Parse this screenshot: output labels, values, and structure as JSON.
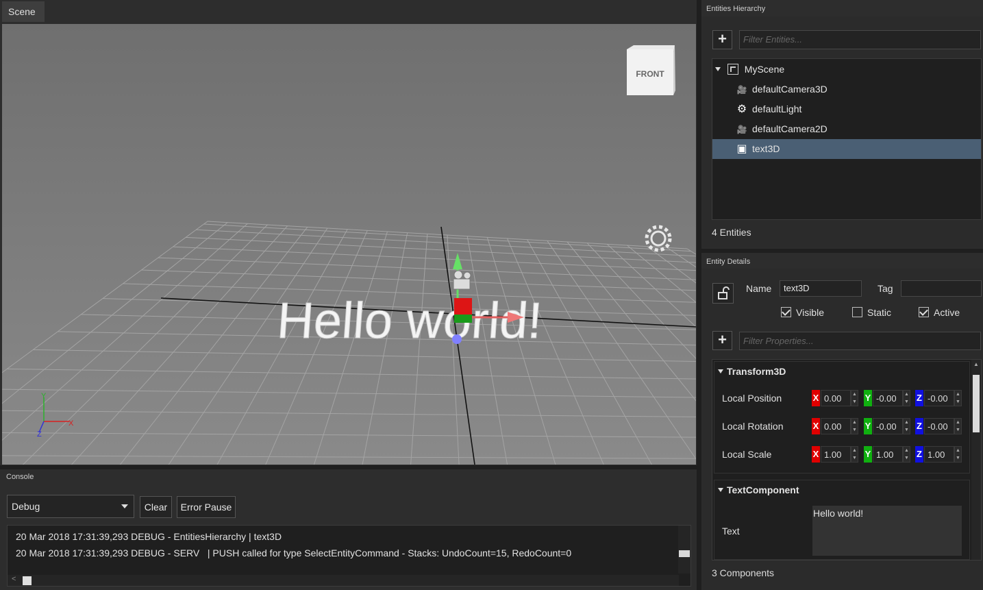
{
  "scene": {
    "tab_label": "Scene",
    "cube_face": "FRONT",
    "hello_text": "Hello world!",
    "axes": {
      "x": "X",
      "y": "Y",
      "z": "Z"
    }
  },
  "console": {
    "title": "Console",
    "level_select": "Debug",
    "clear_label": "Clear",
    "error_pause_label": "Error Pause",
    "lines": [
      "20 Mar 2018 17:31:39,293 DEBUG - EntitiesHierarchy | text3D",
      "20 Mar 2018 17:31:39,293 DEBUG - SERV   | PUSH called for type SelectEntityCommand - Stacks: UndoCount=15, RedoCount=0"
    ]
  },
  "hierarchy": {
    "title": "Entities Hierarchy",
    "filter_placeholder": "Filter Entities...",
    "root": "MyScene",
    "items": [
      {
        "label": "defaultCamera3D",
        "icon": "camera-icon"
      },
      {
        "label": "defaultLight",
        "icon": "light-icon"
      },
      {
        "label": "defaultCamera2D",
        "icon": "camera-icon"
      },
      {
        "label": "text3D",
        "icon": "cube-icon",
        "selected": true
      }
    ],
    "count": "4 Entities"
  },
  "details": {
    "title": "Entity Details",
    "name_label": "Name",
    "name_value": "text3D",
    "tag_label": "Tag",
    "tag_value": "",
    "visible_label": "Visible",
    "visible": true,
    "static_label": "Static",
    "static": false,
    "active_label": "Active",
    "active": true,
    "filter_placeholder": "Filter Properties...",
    "transform": {
      "title": "Transform3D",
      "rows": [
        {
          "label": "Local Position",
          "x": "0.00",
          "y": "-0.00",
          "z": "-0.00"
        },
        {
          "label": "Local Rotation",
          "x": "0.00",
          "y": "-0.00",
          "z": "-0.00"
        },
        {
          "label": "Local Scale",
          "x": "1.00",
          "y": "1.00",
          "z": "1.00"
        }
      ]
    },
    "text_component": {
      "title": "TextComponent",
      "label": "Text",
      "value": "Hello world!"
    },
    "count": "3 Components"
  },
  "colors": {
    "axis_x": "#e00000",
    "axis_y": "#10b010",
    "axis_z": "#1010e0",
    "selection": "#4a5f74"
  }
}
